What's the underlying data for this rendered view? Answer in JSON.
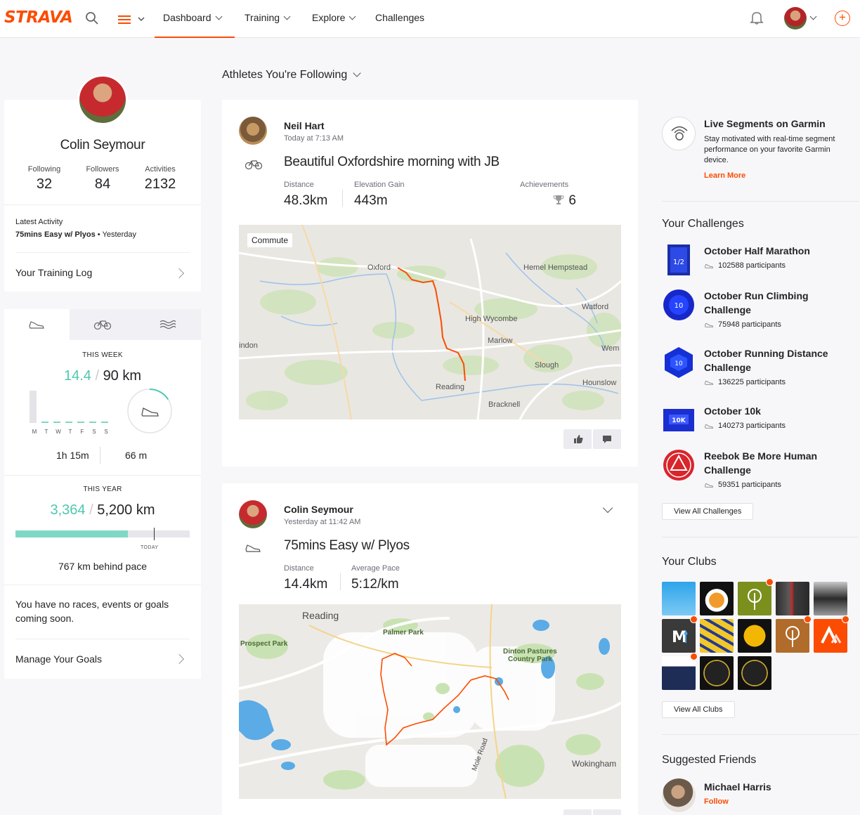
{
  "nav": {
    "logo": "STRAVA",
    "items": [
      {
        "label": "Dashboard",
        "active": true
      },
      {
        "label": "Training"
      },
      {
        "label": "Explore"
      },
      {
        "label": "Challenges"
      }
    ]
  },
  "profile": {
    "name": "Colin Seymour",
    "stats": [
      {
        "label": "Following",
        "value": "32"
      },
      {
        "label": "Followers",
        "value": "84"
      },
      {
        "label": "Activities",
        "value": "2132"
      }
    ],
    "latest_label": "Latest Activity",
    "latest_title": "75mins Easy w/ Plyos",
    "latest_sep": " • ",
    "latest_when": "Yesterday",
    "training_log": "Your Training Log"
  },
  "weekly": {
    "label": "THIS WEEK",
    "current": "14.4",
    "sep": " / ",
    "goal": "90 km",
    "goal_progress": 0.16,
    "days": [
      "M",
      "T",
      "W",
      "T",
      "F",
      "S",
      "S"
    ],
    "day_values": [
      1.0,
      0.05,
      0.05,
      0.05,
      0.05,
      0.05,
      0.05
    ],
    "time": "1h 15m",
    "elevation": "66 m"
  },
  "yearly": {
    "label": "THIS YEAR",
    "current": "3,364",
    "sep": " / ",
    "goal": "5,200 km",
    "progress": 0.647,
    "today_marker": 0.795,
    "today_label": "TODAY",
    "behind": "767 km behind pace"
  },
  "goals": {
    "text": "You have no races, events or goals coming soon.",
    "manage": "Manage Your Goals"
  },
  "feed": {
    "header": "Athletes You're Following",
    "activities": [
      {
        "athlete": "Neil Hart",
        "time": "Today at 7:13 AM",
        "type": "bike",
        "title": "Beautiful Oxfordshire morning with JB",
        "metrics": [
          {
            "label": "Distance",
            "value": "48.3km"
          },
          {
            "label": "Elevation Gain",
            "value": "443m"
          }
        ],
        "achievements_label": "Achievements",
        "achievements": "6",
        "badge": "Commute",
        "map_labels": [
          "Oxford",
          "Hemel Hempstead",
          "Watford",
          "High Wycombe",
          "Marlow",
          "indon",
          "Wem",
          "Slough",
          "Hounslow",
          "Reading",
          "Bracknell"
        ]
      },
      {
        "athlete": "Colin Seymour",
        "time": "Yesterday at 11:42 AM",
        "type": "run",
        "title": "75mins Easy w/ Plyos",
        "metrics": [
          {
            "label": "Distance",
            "value": "14.4km"
          },
          {
            "label": "Average Pace",
            "value": "5:12/km"
          }
        ],
        "map_labels": [
          "Reading",
          "Palmer Park",
          "Prospect Park",
          "Dinton Pastures",
          "Country Park",
          "Mole Road",
          "Wokingham"
        ]
      }
    ]
  },
  "sidebar": {
    "garmin": {
      "title": "Live Segments on Garmin",
      "desc": "Stay motivated with real-time segment performance on your favorite Garmin device.",
      "link": "Learn More"
    },
    "challenges_title": "Your Challenges",
    "challenges": [
      {
        "title": "October Half Marathon",
        "participants": "102588 participants"
      },
      {
        "title": "October Run Climbing Challenge",
        "participants": "75948 participants"
      },
      {
        "title": "October Running Distance Challenge",
        "participants": "136225 participants"
      },
      {
        "title": "October 10k",
        "participants": "140273 participants"
      },
      {
        "title": "Reebok Be More Human Challenge",
        "participants": "59351 participants"
      }
    ],
    "challenge_icon_text": [
      "1/2",
      "10",
      "10",
      "10K",
      ""
    ],
    "view_all_challenges": "View All Challenges",
    "clubs_title": "Your Clubs",
    "club_icon_text": [
      "M"
    ],
    "view_all_clubs": "View All Clubs",
    "friends_title": "Suggested Friends",
    "friend": {
      "name": "Michael Harris",
      "action": "Follow"
    }
  },
  "colors": {
    "brand": "#fc4c02",
    "teal": "#4fc7b0",
    "route": "#fc4c02"
  }
}
